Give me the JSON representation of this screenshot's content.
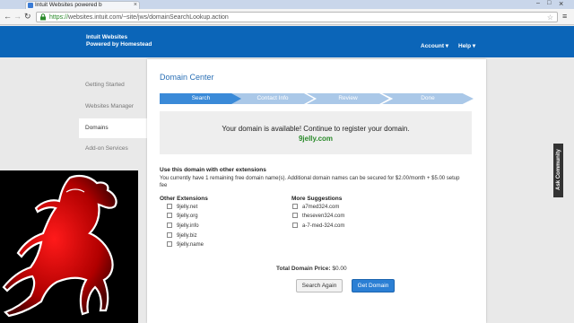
{
  "browser": {
    "tab_title": "Intuit Websites powered b",
    "url_scheme": "https://",
    "url_rest": "websites.intuit.com/~site/jws/domainSearchLookup.action"
  },
  "header": {
    "brand_line1": "Intuit Websites",
    "brand_line2": "Powered by Homestead",
    "account_label": "Account ▾",
    "help_label": "Help ▾"
  },
  "sidebar": {
    "items": [
      {
        "label": "Getting Started"
      },
      {
        "label": "Websites Manager"
      },
      {
        "label": "Domains"
      },
      {
        "label": "Add-on Services"
      }
    ]
  },
  "main": {
    "title": "Domain Center",
    "steps": [
      "Search",
      "Contact Info",
      "Review",
      "Done"
    ],
    "available_message": "Your domain is available! Continue to register your domain.",
    "available_domain": "9jelly.com",
    "extensions_title": "Use this domain with other extensions",
    "extensions_desc": "You currently have 1 remaining free domain name(s). Additional domain names can be secured for $2.00/month + $5.00 setup fee",
    "other_title": "Other Extensions",
    "other_options": [
      "9jelly.net",
      "9jelly.org",
      "9jelly.info",
      "9jelly.biz",
      "9jelly.name"
    ],
    "suggest_title": "More Suggestions",
    "suggest_options": [
      "a7med324.com",
      "theseven324.com",
      "a-7-med-324.com"
    ],
    "total_label": "Total Domain Price:",
    "total_value": "$0.00",
    "search_again_label": "Search Again",
    "get_domain_label": "Get Domain"
  },
  "community": {
    "label": "Ask Community"
  },
  "colors": {
    "header_blue": "#0b65b8",
    "step_active": "#3a8ad8",
    "step_inactive": "#aac8e8",
    "domain_green": "#2a8a2a"
  }
}
